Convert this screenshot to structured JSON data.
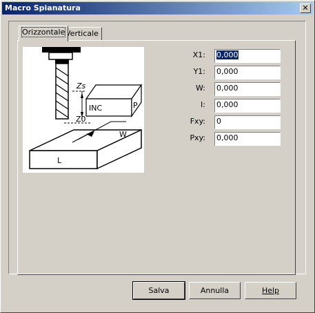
{
  "window": {
    "title": "Macro Spianatura"
  },
  "tabs": [
    {
      "label": "Orizzontale",
      "active": true
    },
    {
      "label": "Verticale",
      "active": false
    }
  ],
  "diagram": {
    "labels": {
      "zs": "Zs",
      "inc": "INC",
      "p": "P",
      "z0": "Z0",
      "w": "W",
      "l": "L"
    }
  },
  "fields": [
    {
      "label": "X1:",
      "value": "0,000",
      "selected": true
    },
    {
      "label": "Y1:",
      "value": "0,000"
    },
    {
      "label": "W:",
      "value": "0,000"
    },
    {
      "label": "I:",
      "value": "0,000"
    },
    {
      "label": "Fxy:",
      "value": "0"
    },
    {
      "label": "Pxy:",
      "value": "0,000"
    }
  ],
  "buttons": {
    "save": "Salva",
    "cancel": "Annulla",
    "help": "Help"
  }
}
